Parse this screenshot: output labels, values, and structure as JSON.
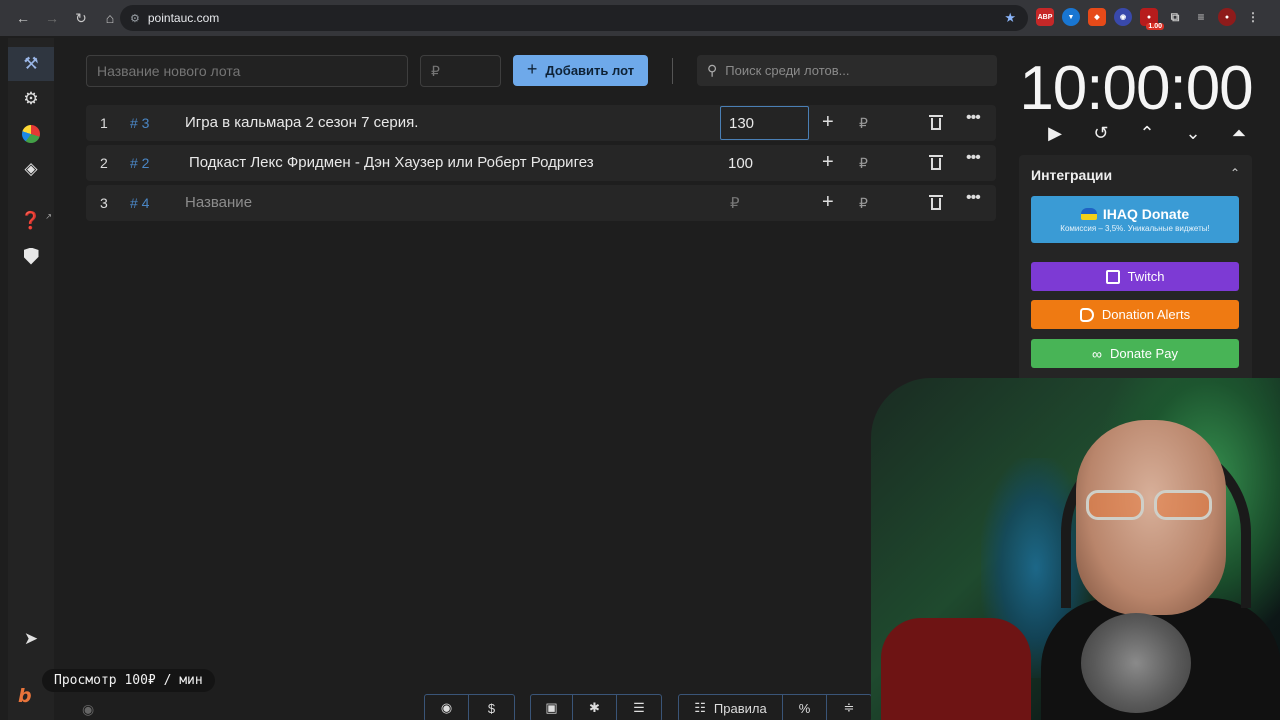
{
  "browser": {
    "url": "pointauc.com",
    "extension_badge": "1.00",
    "ext_abp": "ABP"
  },
  "toolbar": {
    "lot_name_placeholder": "Название нового лота",
    "price_placeholder": "₽",
    "add_label": "Добавить лот",
    "search_placeholder": "Поиск среди лотов..."
  },
  "lots": [
    {
      "index": "1",
      "fast_id": "# 3",
      "name": "Игра в кальмара 2 сезон 7 серия.",
      "amount": "130",
      "currency": "₽"
    },
    {
      "index": "2",
      "fast_id": "# 2",
      "name": "Подкаст Лекс Фридмен - Дэн Хаузер или Роберт Родригез",
      "amount": "100",
      "currency": "₽"
    },
    {
      "index": "3",
      "fast_id": "# 4",
      "name_placeholder": "Название",
      "amount_placeholder": "₽",
      "currency": "₽"
    }
  ],
  "timer": {
    "value": "10:00:00"
  },
  "integrations": {
    "title": "Интеграции",
    "ihaq_label": "IHAQ Donate",
    "ihaq_sub": "Комиссия – 3,5%. Уникальные виджеты!",
    "twitch_label": "Twitch",
    "donation_alerts_label": "Donation Alerts",
    "donate_pay_label": "Donate Pay"
  },
  "bottom": {
    "rules_label": "Правила",
    "percent_label": "%"
  },
  "overlay": {
    "tag": "Просмотр 100₽ / мин"
  },
  "colors": {
    "accent": "#6ea9ea",
    "twitch": "#7d3ad4",
    "donation_alerts": "#ef7a12",
    "donate_pay": "#48b456",
    "ihaq": "#3a9bd5"
  }
}
